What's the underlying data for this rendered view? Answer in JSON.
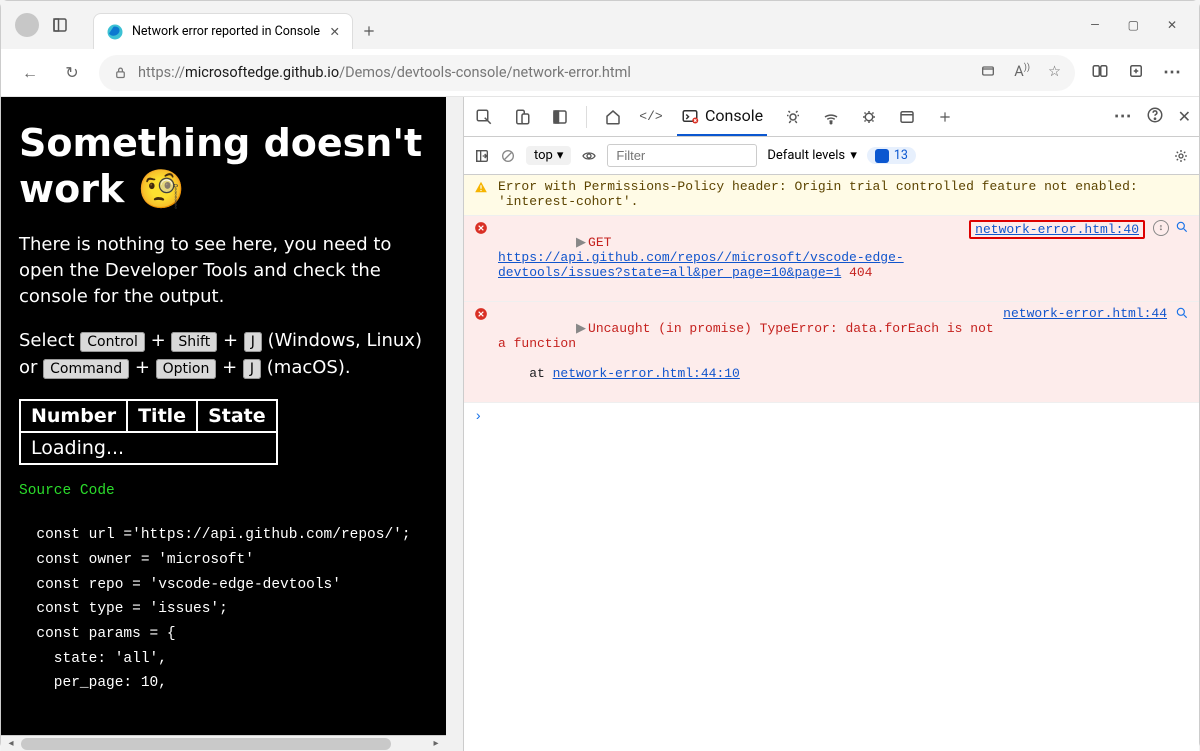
{
  "window": {
    "title": "Network error reported in Console"
  },
  "address": {
    "scheme": "https://",
    "host": "microsoftedge.github.io",
    "path": "/Demos/devtools-console/network-error.html"
  },
  "page": {
    "heading": "Something doesn't work 🧐",
    "para": "There is nothing to see here, you need to open the Developer Tools and check the console for the output.",
    "kbd_line_1a": "Select ",
    "kbd_ctrl": "Control",
    "plus": " + ",
    "kbd_shift": "Shift",
    "kbd_j": "J",
    "winlinux": " (Windows, Linux) or ",
    "kbd_cmd": "Command",
    "kbd_opt": "Option",
    "macos": " (macOS).",
    "table": {
      "h1": "Number",
      "h2": "Title",
      "h3": "State",
      "cell": "Loading..."
    },
    "src_head": "Source Code",
    "src": "\n  const url ='https://api.github.com/repos/';\n  const owner = 'microsoft'\n  const repo = 'vscode-edge-devtools'\n  const type = 'issues';\n  const params = {\n    state: 'all',\n    per_page: 10,"
  },
  "devtools": {
    "tab_console": "Console",
    "context": "top",
    "filter_ph": "Filter",
    "levels": "Default levels",
    "issues": "13",
    "warn_msg": "Error with Permissions-Policy header: Origin trial controlled feature not enabled: 'interest-cohort'.",
    "err1_verb": "GET",
    "err1_url": "https://api.github.com/repos//microsoft/vscode-edge-devtools/issues?state=all&per_page=10&page=1",
    "err1_code": "404",
    "err1_src": "network-error.html:40",
    "err2_msg": "Uncaught (in promise) TypeError: data.forEach is not a function",
    "err2_at": "    at ",
    "err2_at_link": "network-error.html:44:10",
    "err2_src": "network-error.html:44"
  }
}
